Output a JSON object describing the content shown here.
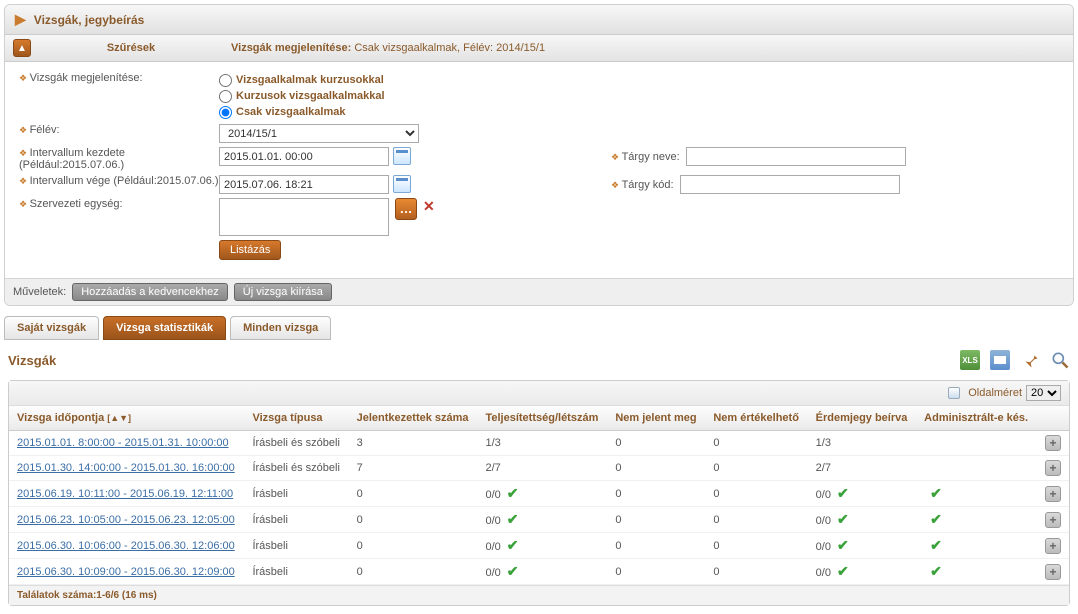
{
  "header": {
    "title": "Vizsgák, jegybeírás"
  },
  "filterBar": {
    "title": "Szűrések",
    "summaryLabel": "Vizsgák megjelenítése:",
    "summaryValue": "Csak vizsgaalkalmak, Félév: 2014/15/1"
  },
  "filters": {
    "displayLabel": "Vizsgák megjelenítése:",
    "radios": {
      "r1": "Vizsgaalkalmak kurzusokkal",
      "r2": "Kurzusok vizsgaalkalmakkal",
      "r3": "Csak vizsgaalkalmak"
    },
    "semesterLabel": "Félév:",
    "semesterValue": "2014/15/1",
    "intervalStartLabel": "Intervallum kezdete (Például:2015.07.06.)",
    "intervalStartValue": "2015.01.01. 00:00",
    "intervalEndLabel": "Intervallum vége (Például:2015.07.06.)",
    "intervalEndValue": "2015.07.06. 18:21",
    "orgLabel": "Szervezeti egység:",
    "subjectNameLabel": "Tárgy neve:",
    "subjectCodeLabel": "Tárgy kód:",
    "listBtn": "Listázás"
  },
  "actions": {
    "label": "Műveletek:",
    "fav": "Hozzáadás a kedvencekhez",
    "newExam": "Új vizsga kiírása"
  },
  "tabs": {
    "own": "Saját vizsgák",
    "stats": "Vizsga statisztikák",
    "all": "Minden vizsga"
  },
  "section": {
    "title": "Vizsgák"
  },
  "gridTop": {
    "pageSizeLabel": "Oldalméret",
    "pageSize": "20"
  },
  "columns": {
    "time": "Vizsga időpontja",
    "type": "Vizsga típusa",
    "registered": "Jelentkezettek száma",
    "completed": "Teljesítettség/létszám",
    "noshow": "Nem jelent meg",
    "noteval": "Nem értékelhető",
    "grade": "Érdemjegy beírva",
    "admin": "Adminisztrált-e kés."
  },
  "rows": [
    {
      "time": "2015.01.01. 8:00:00 - 2015.01.31. 10:00:00",
      "type": "Írásbeli és szóbeli",
      "reg": "3",
      "comp": "1/3",
      "compCheck": false,
      "noshow": "0",
      "noteval": "0",
      "grade": "1/3",
      "gradeCheck": false,
      "adminCheck": false
    },
    {
      "time": "2015.01.30. 14:00:00 - 2015.01.30. 16:00:00",
      "type": "Írásbeli és szóbeli",
      "reg": "7",
      "comp": "2/7",
      "compCheck": false,
      "noshow": "0",
      "noteval": "0",
      "grade": "2/7",
      "gradeCheck": false,
      "adminCheck": false
    },
    {
      "time": "2015.06.19. 10:11:00 - 2015.06.19. 12:11:00",
      "type": "Írásbeli",
      "reg": "0",
      "comp": "0/0",
      "compCheck": true,
      "noshow": "0",
      "noteval": "0",
      "grade": "0/0",
      "gradeCheck": true,
      "adminCheck": true
    },
    {
      "time": "2015.06.23. 10:05:00 - 2015.06.23. 12:05:00",
      "type": "Írásbeli",
      "reg": "0",
      "comp": "0/0",
      "compCheck": true,
      "noshow": "0",
      "noteval": "0",
      "grade": "0/0",
      "gradeCheck": true,
      "adminCheck": true
    },
    {
      "time": "2015.06.30. 10:06:00 - 2015.06.30. 12:06:00",
      "type": "Írásbeli",
      "reg": "0",
      "comp": "0/0",
      "compCheck": true,
      "noshow": "0",
      "noteval": "0",
      "grade": "0/0",
      "gradeCheck": true,
      "adminCheck": true
    },
    {
      "time": "2015.06.30. 10:09:00 - 2015.06.30. 12:09:00",
      "type": "Írásbeli",
      "reg": "0",
      "comp": "0/0",
      "compCheck": true,
      "noshow": "0",
      "noteval": "0",
      "grade": "0/0",
      "gradeCheck": true,
      "adminCheck": true
    }
  ],
  "footer": {
    "text": "Találatok száma:1-6/6 (16 ms)"
  }
}
